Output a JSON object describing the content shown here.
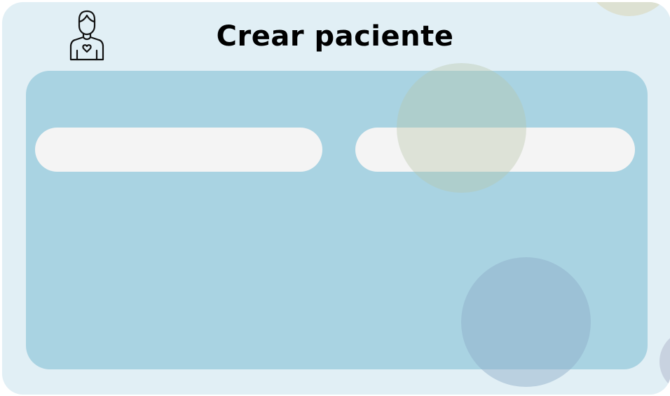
{
  "page": {
    "title": "Crear paciente",
    "icon": "patient-icon"
  },
  "form": {
    "fields": [
      {
        "value": "",
        "placeholder": ""
      },
      {
        "value": "",
        "placeholder": ""
      }
    ]
  },
  "colors": {
    "page_background": "#e1eff5",
    "panel_background": "#a9d3e2",
    "input_background": "#f4f4f4",
    "title_text": "#000000"
  }
}
